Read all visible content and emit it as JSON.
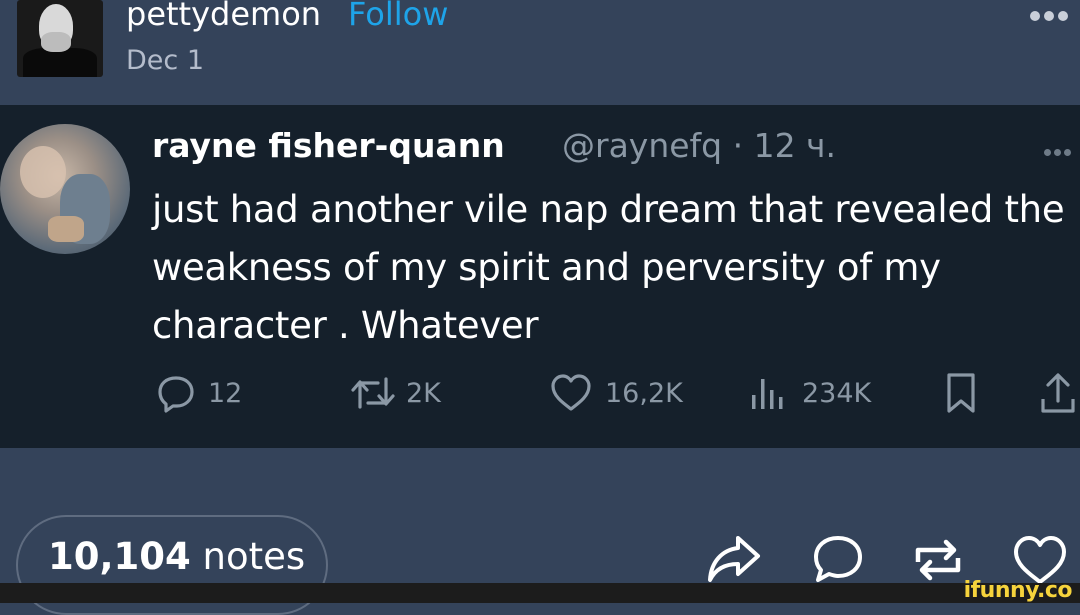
{
  "post": {
    "username": "pettydemon",
    "follow_label": "Follow",
    "date": "Dec 1",
    "menu_icon": "more-horizontal-icon"
  },
  "tweet": {
    "author": "rayne fisher-quann",
    "meta": "@raynefq · 12 ч.",
    "text": "just had another  vile nap dream that revealed the weakness of my spirit and perversity of my character . Whatever",
    "actions": {
      "replies": "12",
      "retweets": "2K",
      "likes": "16,2K",
      "views": "234K"
    }
  },
  "notes": {
    "count": "10,104",
    "label": "notes"
  },
  "watermark": "ifunny.co",
  "colors": {
    "tumblr_bg": "#34435a",
    "tweet_bg": "#15202b",
    "follow_blue": "#1ea4e9",
    "tweet_secondary": "#8b98a5",
    "watermark_yellow": "#f6d33c"
  }
}
